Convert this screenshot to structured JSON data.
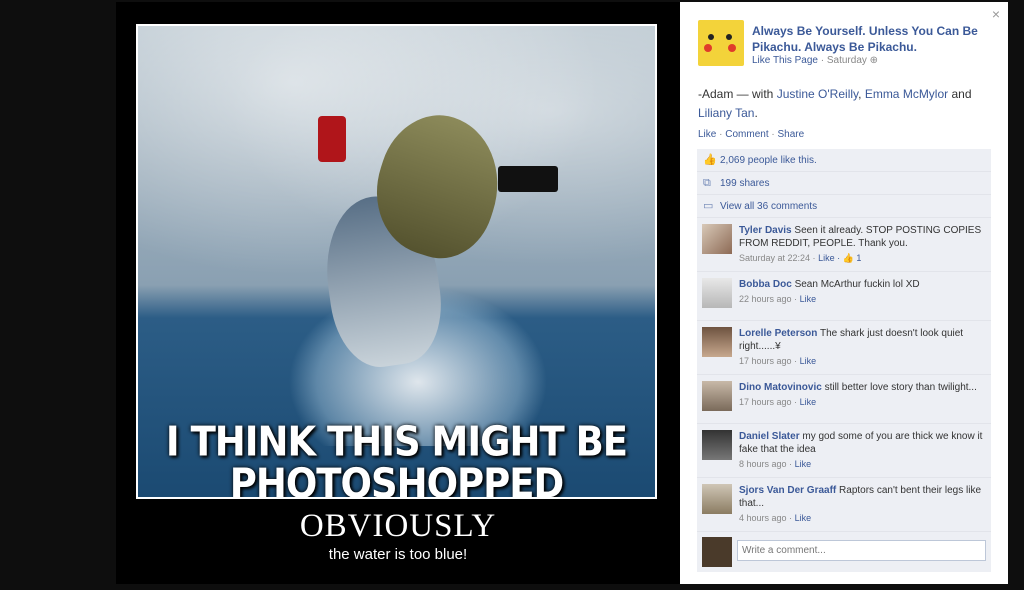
{
  "poster": {
    "caption_line1": "I THINK THIS MIGHT BE",
    "caption_line2": "PHOTOSHOPPED",
    "title": "OBVIOUSLY",
    "subtitle": "the water is too blue!"
  },
  "sidebar": {
    "close": "×",
    "page_name": "Always Be Yourself. Unless You Can Be Pikachu. Always Be Pikachu.",
    "like_page": "Like This Page",
    "time": "· Saturday",
    "post_text_prefix": "-Adam — with",
    "tagged_1": "Justine O'Reilly",
    "tagged_2": "Emma McMylor",
    "and": "and",
    "tagged_3": "Liliany Tan",
    "actions": {
      "like": "Like",
      "comment": "Comment",
      "share": "Share",
      "sep": " · "
    },
    "likes": "2,069 people like this.",
    "shares": "199 shares",
    "view_comments": "View all 36 comments",
    "comments": [
      {
        "author": "Tyler Davis",
        "text": "Seen it already. STOP POSTING COPIES FROM REDDIT, PEOPLE. Thank you.",
        "time": "Saturday at 22:24 ·",
        "like": "Like",
        "extra": "· 👍 1"
      },
      {
        "author": "Bobba Doc",
        "text": "Sean McArthur fuckin lol XD",
        "time": "22 hours ago ·",
        "like": "Like",
        "extra": ""
      },
      {
        "author": "Lorelle Peterson",
        "text": "The shark just doesn't look quiet right......¥",
        "time": "17 hours ago ·",
        "like": "Like",
        "extra": ""
      },
      {
        "author": "Dino Matovinovic",
        "text": "still better love story than twilight...",
        "time": "17 hours ago ·",
        "like": "Like",
        "extra": ""
      },
      {
        "author": "Daniel Slater",
        "text": "my god some of you are thick we know it fake that the idea",
        "time": "8 hours ago ·",
        "like": "Like",
        "extra": ""
      },
      {
        "author": "Sjors Van Der Graaff",
        "text": "Raptors can't bent their legs like that...",
        "time": "4 hours ago ·",
        "like": "Like",
        "extra": ""
      }
    ],
    "write_placeholder": "Write a comment..."
  }
}
